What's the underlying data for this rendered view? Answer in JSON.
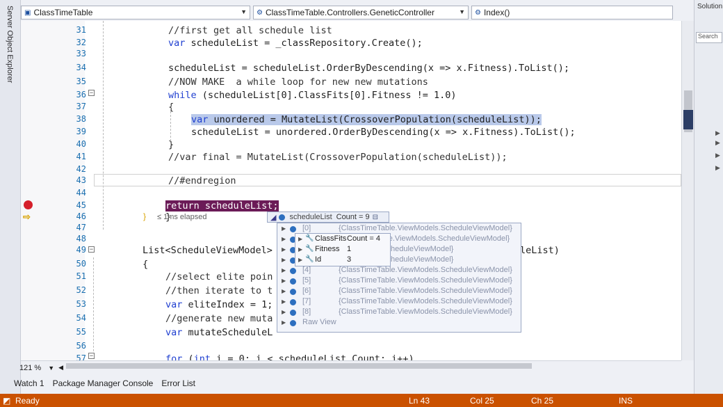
{
  "navbar": {
    "project": "ClassTimeTable",
    "type": "ClassTimeTable.Controllers.GeneticController",
    "member": "Index()"
  },
  "left_panel": {
    "title": "Server Object Explorer"
  },
  "right_panel": {
    "title": "Solution",
    "search": "Search"
  },
  "editor": {
    "lines": [
      {
        "n": "31",
        "parts": [
          {
            "t": "//first get all schedule list",
            "c": "cm"
          }
        ]
      },
      {
        "n": "32",
        "parts": [
          {
            "t": "var",
            "c": "kw"
          },
          {
            "t": " scheduleList = _classRepository.Create();",
            "c": ""
          }
        ]
      },
      {
        "n": "33",
        "parts": []
      },
      {
        "n": "34",
        "parts": [
          {
            "t": "scheduleList = scheduleList.OrderByDescending(x => x.Fitness).ToList();",
            "c": ""
          }
        ]
      },
      {
        "n": "35",
        "parts": [
          {
            "t": "//NOW MAKE  a while loop for new new mutations",
            "c": "cm"
          }
        ]
      },
      {
        "n": "36",
        "parts": [
          {
            "t": "while",
            "c": "kw"
          },
          {
            "t": " (scheduleList[0].ClassFits[0].Fitness != 1.0)",
            "c": ""
          }
        ]
      },
      {
        "n": "37",
        "parts": [
          {
            "t": "{",
            "c": ""
          }
        ]
      },
      {
        "n": "38",
        "parts": [
          {
            "t": "var",
            "c": "kw sel"
          },
          {
            "t": " unordered = MutateList(CrossoverPopulation(scheduleList));",
            "c": "sel"
          }
        ]
      },
      {
        "n": "39",
        "parts": [
          {
            "t": "scheduleList = unordered.OrderByDescending(x => x.Fitness).ToList();",
            "c": ""
          }
        ]
      },
      {
        "n": "40",
        "parts": [
          {
            "t": "}",
            "c": ""
          }
        ]
      },
      {
        "n": "41",
        "parts": [
          {
            "t": "//var final = MutateList(CrossoverPopulation(scheduleList));",
            "c": "cm"
          }
        ]
      },
      {
        "n": "42",
        "parts": []
      },
      {
        "n": "43",
        "parts": [
          {
            "t": "//#endregion",
            "c": "cm"
          }
        ]
      },
      {
        "n": "44",
        "parts": []
      },
      {
        "n": "45",
        "parts": [
          {
            "t": "return scheduleList;",
            "c": "ret"
          }
        ]
      },
      {
        "n": "46",
        "parts": [
          {
            "t": "}",
            "c": ""
          }
        ]
      },
      {
        "n": "47",
        "parts": []
      },
      {
        "n": "48",
        "parts": []
      },
      {
        "n": "49",
        "parts": [
          {
            "t": "List<ScheduleViewModel>",
            "c": ""
          }
        ]
      },
      {
        "n": "50",
        "parts": [
          {
            "t": "{",
            "c": ""
          }
        ]
      },
      {
        "n": "51",
        "parts": [
          {
            "t": "//select elite poin",
            "c": "cm"
          }
        ]
      },
      {
        "n": "52",
        "parts": [
          {
            "t": "//then iterate to t",
            "c": "cm"
          }
        ]
      },
      {
        "n": "53",
        "parts": [
          {
            "t": "var",
            "c": "kw"
          },
          {
            "t": " eliteIndex = 1;",
            "c": ""
          }
        ]
      },
      {
        "n": "54",
        "parts": [
          {
            "t": "//generate new muta",
            "c": "cm"
          }
        ]
      },
      {
        "n": "55",
        "parts": [
          {
            "t": "var",
            "c": "kw"
          },
          {
            "t": " mutateScheduleL",
            "c": ""
          }
        ]
      },
      {
        "n": "56",
        "parts": []
      },
      {
        "n": "57",
        "parts": [
          {
            "t": "for",
            "c": "kw"
          },
          {
            "t": " (",
            "c": ""
          },
          {
            "t": "int",
            "c": "kw"
          },
          {
            "t": " i = 0; i < scheduleList.Count; i++)",
            "c": ""
          }
        ]
      }
    ],
    "line49_tail": "leList)",
    "elapsed": "≤ 1ms elapsed"
  },
  "datatip": {
    "name": "scheduleList",
    "value": "Count = 9",
    "items": [
      {
        "idx": "[0]",
        "val": "{ClassTimeTable.ViewModels.ScheduleViewModel}"
      },
      {
        "idx": "",
        "val": "ClassTimeTable.ViewModels.ScheduleViewModel}"
      },
      {
        "idx": "",
        "val": "ViewModels.ScheduleViewModel}"
      },
      {
        "idx": "",
        "val": "ViewModels.ScheduleViewModel}"
      },
      {
        "idx": "[4]",
        "val": "{ClassTimeTable.ViewModels.ScheduleViewModel}"
      },
      {
        "idx": "[5]",
        "val": "{ClassTimeTable.ViewModels.ScheduleViewModel}"
      },
      {
        "idx": "[6]",
        "val": "{ClassTimeTable.ViewModels.ScheduleViewModel}"
      },
      {
        "idx": "[7]",
        "val": "{ClassTimeTable.ViewModels.ScheduleViewModel}"
      },
      {
        "idx": "[8]",
        "val": "{ClassTimeTable.ViewModels.ScheduleViewModel}"
      },
      {
        "idx": "Raw View",
        "val": ""
      }
    ],
    "props": [
      {
        "name": "ClassFits",
        "val": "Count = 4"
      },
      {
        "name": "Fitness",
        "val": "1"
      },
      {
        "name": "Id",
        "val": "3"
      }
    ]
  },
  "zoom": "121 %",
  "tool_tabs": [
    "Watch 1",
    "Package Manager Console",
    "Error List"
  ],
  "status": {
    "state": "Ready",
    "ln": "Ln 43",
    "col": "Col 25",
    "ch": "Ch 25",
    "mode": "INS"
  },
  "colors": {
    "status_bar": "#ca5100",
    "breakpoint": "#d51f2b",
    "keyword": "#1f3fd0",
    "line_number": "#1a6fb0",
    "return_highlight": "#6b1b57"
  }
}
